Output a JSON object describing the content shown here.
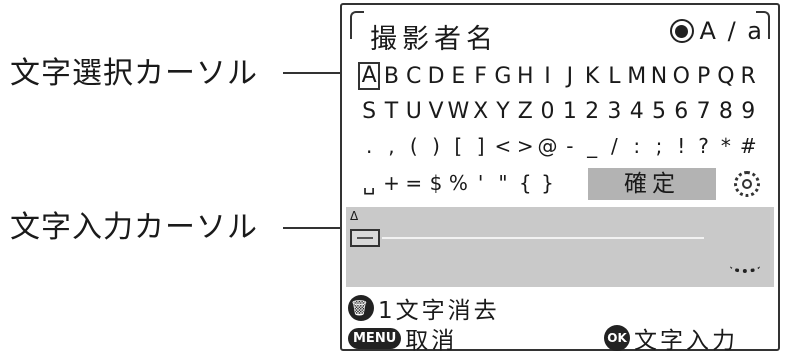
{
  "annotations": {
    "char_select_cursor": "文字選択カーソル",
    "char_input_cursor": "文字入力カーソル"
  },
  "screen": {
    "title": "撮影者名",
    "input_mode": "A / a",
    "char_rows": [
      [
        "A",
        "B",
        "C",
        "D",
        "E",
        "F",
        "G",
        "H",
        "I",
        "J",
        "K",
        "L",
        "M",
        "N",
        "O",
        "P",
        "Q",
        "R"
      ],
      [
        "S",
        "T",
        "U",
        "V",
        "W",
        "X",
        "Y",
        "Z",
        "0",
        "1",
        "2",
        "3",
        "4",
        "5",
        "6",
        "7",
        "8",
        "9"
      ],
      [
        ".",
        ",",
        "(",
        ")",
        "[",
        "]",
        "<",
        ">",
        "@",
        "-",
        "_",
        "/",
        ":",
        ";",
        "!",
        "?",
        "*",
        "#"
      ],
      [
        "␣",
        "+",
        "=",
        "$",
        "%",
        "'",
        "\"",
        "{",
        "}"
      ]
    ],
    "selected_char": "A",
    "confirm_label": "確定",
    "caret_mark": "Δ",
    "input_value": "",
    "hints": {
      "delete_label": "1文字消去",
      "menu_badge": "MENU",
      "cancel_label": "取消",
      "ok_badge": "OK",
      "input_label": "文字入力"
    }
  },
  "icons": [
    "dial-mode-icon",
    "gear-icon",
    "trash-icon",
    "dial-hint-icon"
  ],
  "colors": {
    "confirm_bg": "#b3b3b3",
    "input_area_bg": "#c9c9c9"
  }
}
